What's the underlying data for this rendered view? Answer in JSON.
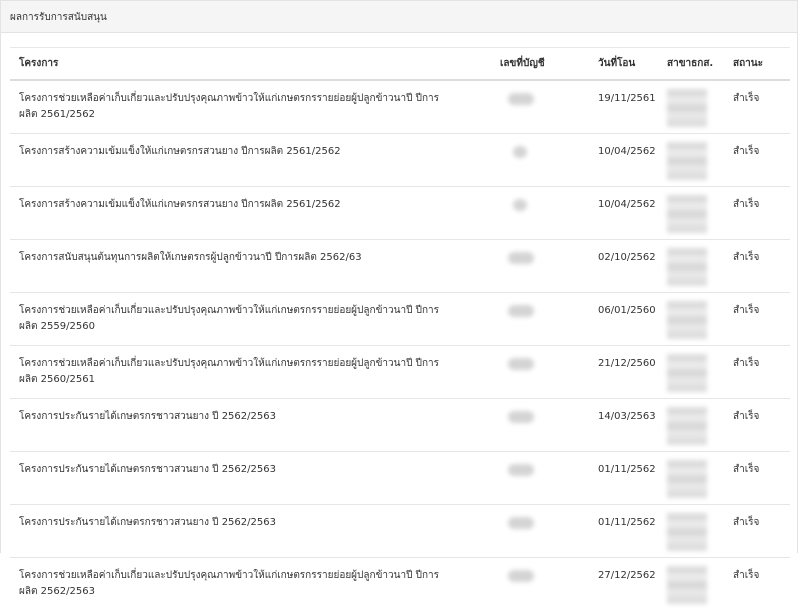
{
  "panel": {
    "title": "ผลการรับการสนับสนุน"
  },
  "table": {
    "columns": {
      "project": "โครงการ",
      "account": "เลขที่บัญชี",
      "date": "วันที่โอน",
      "branch": "สาขาธกส.",
      "status": "สถานะ"
    },
    "rows": [
      {
        "project": "โครงการช่วยเหลือค่าเก็บเกี่ยวและปรับปรุงคุณภาพข้าวให้แก่เกษตรกรรายย่อยผู้ปลูกข้าวนาปี ปีการผลิต 2561/2562",
        "date": "19/11/2561",
        "status": "สำเร็จ"
      },
      {
        "project": "โครงการสร้างความเข้มแข็งให้แก่เกษตรกรสวนยาง ปีการผลิต 2561/2562",
        "date": "10/04/2562",
        "status": "สำเร็จ"
      },
      {
        "project": "โครงการสร้างความเข้มแข็งให้แก่เกษตรกรสวนยาง ปีการผลิต 2561/2562",
        "date": "10/04/2562",
        "status": "สำเร็จ"
      },
      {
        "project": "โครงการสนับสนุนต้นทุนการผลิตให้เกษตรกรผู้ปลูกข้าวนาปี ปีการผลิต 2562/63",
        "date": "02/10/2562",
        "status": "สำเร็จ"
      },
      {
        "project": "โครงการช่วยเหลือค่าเก็บเกี่ยวและปรับปรุงคุณภาพข้าวให้แก่เกษตรกรรายย่อยผู้ปลูกข้าวนาปี ปีการผลิต 2559/2560",
        "date": "06/01/2560",
        "status": "สำเร็จ"
      },
      {
        "project": "โครงการช่วยเหลือค่าเก็บเกี่ยวและปรับปรุงคุณภาพข้าวให้แก่เกษตรกรรายย่อยผู้ปลูกข้าวนาปี ปีการผลิต 2560/2561",
        "date": "21/12/2560",
        "status": "สำเร็จ"
      },
      {
        "project": "โครงการประกันรายได้เกษตรกรชาวสวนยาง ปี 2562/2563",
        "date": "14/03/2563",
        "status": "สำเร็จ"
      },
      {
        "project": "โครงการประกันรายได้เกษตรกรชาวสวนยาง ปี 2562/2563",
        "date": "01/11/2562",
        "status": "สำเร็จ"
      },
      {
        "project": "โครงการประกันรายได้เกษตรกรชาวสวนยาง ปี 2562/2563",
        "date": "01/11/2562",
        "status": "สำเร็จ"
      },
      {
        "project": "โครงการช่วยเหลือค่าเก็บเกี่ยวและปรับปรุงคุณภาพข้าวให้แก่เกษตรกรรายย่อยผู้ปลูกข้าวนาปี ปีการผลิต 2562/2563",
        "date": "27/12/2562",
        "status": "สำเร็จ"
      }
    ]
  }
}
